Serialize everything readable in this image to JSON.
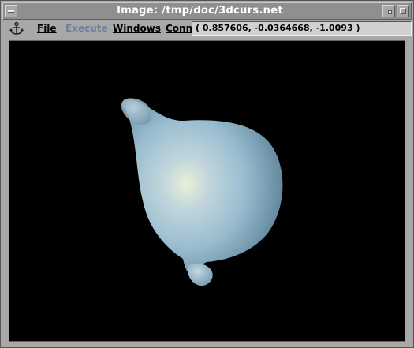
{
  "window": {
    "title": "Image: /tmp/doc/3dcurs.net"
  },
  "menubar": {
    "icon": "anchor-icon",
    "items": [
      {
        "label": "File",
        "enabled": true
      },
      {
        "label": "Execute",
        "enabled": false
      },
      {
        "label": "Windows",
        "enabled": true
      },
      {
        "label": "Conn",
        "enabled": true
      }
    ],
    "cursor_coordinates": "( 0.857606, -0.0364668, -1.0093 )"
  },
  "viewport": {
    "background": "#000000",
    "object_color": "#a9c8dc"
  }
}
